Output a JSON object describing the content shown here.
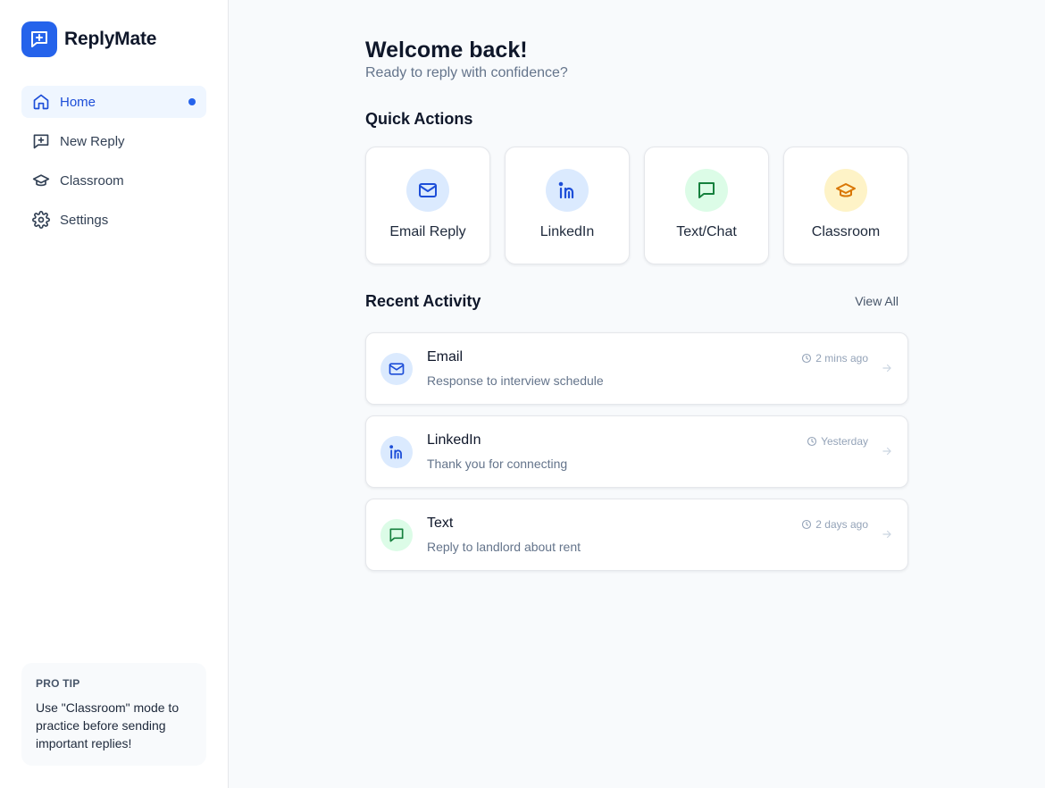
{
  "app": {
    "name": "ReplyMate"
  },
  "colors": {
    "accent": "#2563eb",
    "email_bg": "#dbeafe",
    "linkedin_bg": "#dbeafe",
    "text_bg": "#dcfce7",
    "classroom_bg": "#fef3c7"
  },
  "sidebar": {
    "items": [
      {
        "label": "Home",
        "icon": "home-icon",
        "active": true
      },
      {
        "label": "New Reply",
        "icon": "message-plus-icon"
      },
      {
        "label": "Classroom",
        "icon": "graduation-cap-icon"
      },
      {
        "label": "Settings",
        "icon": "gear-icon"
      }
    ],
    "protip": {
      "label": "PRO TIP",
      "text": "Use \"Classroom\" mode to practice before sending important replies!"
    }
  },
  "main": {
    "welcome": "Welcome back!",
    "subtitle": "Ready to reply with confidence?",
    "quick_actions_title": "Quick Actions",
    "quick_actions": [
      {
        "label": "Email Reply",
        "icon": "mail-icon"
      },
      {
        "label": "LinkedIn",
        "icon": "linkedin-icon"
      },
      {
        "label": "Text/Chat",
        "icon": "chat-icon"
      },
      {
        "label": "Classroom",
        "icon": "graduation-cap-icon"
      }
    ],
    "recent_title": "Recent Activity",
    "view_all": "View All",
    "activity": [
      {
        "title": "Email",
        "desc": "Response to interview schedule",
        "time": "2 mins ago",
        "icon": "mail-icon"
      },
      {
        "title": "LinkedIn",
        "desc": "Thank you for connecting",
        "time": "Yesterday",
        "icon": "linkedin-icon"
      },
      {
        "title": "Text",
        "desc": "Reply to landlord about rent",
        "time": "2 days ago",
        "icon": "chat-icon"
      }
    ]
  }
}
